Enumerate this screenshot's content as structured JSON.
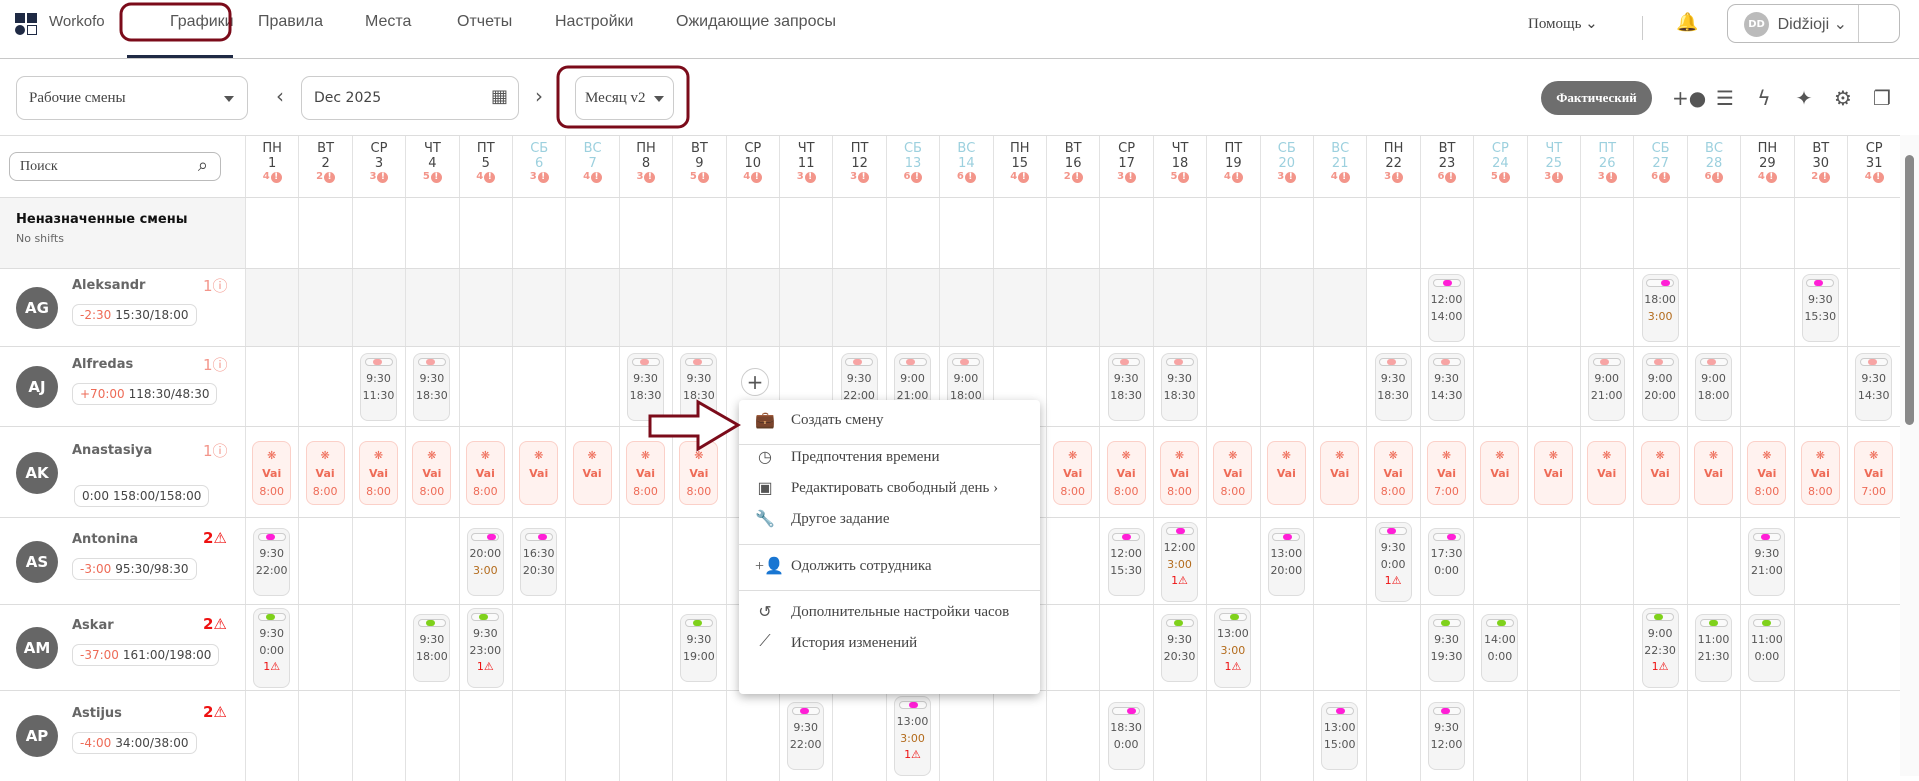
{
  "nav": {
    "brand": "Workofo",
    "tabs": [
      "Графики",
      "Правила",
      "Места",
      "Отчеты",
      "Настройки",
      "Ожидающие запросы"
    ],
    "active_tab": "Графики",
    "help": "Помощь ⌄",
    "user": "Didžioji ⌄",
    "user_initials": "DD"
  },
  "toolbar": {
    "view_select": "Рабочие смены",
    "date": "Dec 2025",
    "mode_select": "Месяц v2",
    "actual_button": "Фактический",
    "icons": [
      "person-add-icon",
      "tune-icon",
      "flash-icon",
      "sparkles-icon",
      "gear-icon",
      "copy-icon"
    ]
  },
  "search": {
    "placeholder": "Поиск"
  },
  "days": [
    {
      "w": "ПН",
      "n": "1",
      "c": "4",
      "we": false
    },
    {
      "w": "ВТ",
      "n": "2",
      "c": "2",
      "we": false
    },
    {
      "w": "СР",
      "n": "3",
      "c": "3",
      "we": false
    },
    {
      "w": "ЧТ",
      "n": "4",
      "c": "5",
      "we": false
    },
    {
      "w": "ПТ",
      "n": "5",
      "c": "4",
      "we": false
    },
    {
      "w": "СБ",
      "n": "6",
      "c": "3",
      "we": true
    },
    {
      "w": "ВС",
      "n": "7",
      "c": "4",
      "we": true
    },
    {
      "w": "ПН",
      "n": "8",
      "c": "3",
      "we": false
    },
    {
      "w": "ВТ",
      "n": "9",
      "c": "5",
      "we": false
    },
    {
      "w": "СР",
      "n": "10",
      "c": "4",
      "we": false
    },
    {
      "w": "ЧТ",
      "n": "11",
      "c": "3",
      "we": false
    },
    {
      "w": "ПТ",
      "n": "12",
      "c": "3",
      "we": false
    },
    {
      "w": "СБ",
      "n": "13",
      "c": "6",
      "we": true
    },
    {
      "w": "ВС",
      "n": "14",
      "c": "6",
      "we": true
    },
    {
      "w": "ПН",
      "n": "15",
      "c": "4",
      "we": false
    },
    {
      "w": "ВТ",
      "n": "16",
      "c": "2",
      "we": false
    },
    {
      "w": "СР",
      "n": "17",
      "c": "3",
      "we": false
    },
    {
      "w": "ЧТ",
      "n": "18",
      "c": "5",
      "we": false
    },
    {
      "w": "ПТ",
      "n": "19",
      "c": "4",
      "we": false
    },
    {
      "w": "СБ",
      "n": "20",
      "c": "3",
      "we": true
    },
    {
      "w": "ВС",
      "n": "21",
      "c": "4",
      "we": true
    },
    {
      "w": "ПН",
      "n": "22",
      "c": "3",
      "we": false
    },
    {
      "w": "ВТ",
      "n": "23",
      "c": "6",
      "we": false
    },
    {
      "w": "СР",
      "n": "24",
      "c": "5",
      "we": true
    },
    {
      "w": "ЧТ",
      "n": "25",
      "c": "3",
      "we": true
    },
    {
      "w": "ПТ",
      "n": "26",
      "c": "3",
      "we": true
    },
    {
      "w": "СБ",
      "n": "27",
      "c": "6",
      "we": true
    },
    {
      "w": "ВС",
      "n": "28",
      "c": "6",
      "we": true
    },
    {
      "w": "ПН",
      "n": "29",
      "c": "4",
      "we": false
    },
    {
      "w": "ВТ",
      "n": "30",
      "c": "2",
      "we": false
    },
    {
      "w": "СР",
      "n": "31",
      "c": "4",
      "we": false
    }
  ],
  "unassigned": {
    "title": "Неназначенные смены",
    "subtitle": "No shifts"
  },
  "employees": [
    {
      "initials": "AG",
      "name": "Aleksandr",
      "alert": "1ⓘ",
      "alert_type": "info",
      "diff": "-2:30",
      "hours": "15:30/18:00",
      "color": "#ff1fd6",
      "unavailable_through_day": 21,
      "shifts": [
        {
          "day": 23,
          "start": "12:00",
          "end": "14:00"
        },
        {
          "day": 27,
          "start": "18:00",
          "end": "3:00"
        },
        {
          "day": 30,
          "start": "9:30",
          "end": "15:30"
        }
      ]
    },
    {
      "initials": "AJ",
      "name": "Alfredas",
      "alert": "1ⓘ",
      "alert_type": "info",
      "diff": "+70:00",
      "hours": "118:30/48:30",
      "color": "#f7a4a4",
      "shifts": [
        {
          "day": 3,
          "start": "9:30",
          "end": "11:30"
        },
        {
          "day": 4,
          "start": "9:30",
          "end": "18:30"
        },
        {
          "day": 8,
          "start": "9:30",
          "end": "18:30"
        },
        {
          "day": 9,
          "start": "9:30",
          "end": "18:30"
        },
        {
          "day": 12,
          "start": "9:30",
          "end": "22:00"
        },
        {
          "day": 13,
          "start": "9:00",
          "end": "21:00"
        },
        {
          "day": 14,
          "start": "9:00",
          "end": "18:00"
        },
        {
          "day": 17,
          "start": "9:30",
          "end": "18:30"
        },
        {
          "day": 18,
          "start": "9:30",
          "end": "18:30"
        },
        {
          "day": 22,
          "start": "9:30",
          "end": "18:30"
        },
        {
          "day": 23,
          "start": "9:30",
          "end": "14:30"
        },
        {
          "day": 26,
          "start": "9:00",
          "end": "21:00"
        },
        {
          "day": 27,
          "start": "9:00",
          "end": "20:00"
        },
        {
          "day": 28,
          "start": "9:00",
          "end": "18:00"
        },
        {
          "day": 31,
          "start": "9:30",
          "end": "14:30"
        }
      ]
    },
    {
      "initials": "AK",
      "name": "Anastasiya",
      "alert": "1ⓘ",
      "alert_type": "info",
      "diff": "0:00",
      "hours": "158:00/158:00",
      "color": "#ee6b57",
      "vacation_label": "Vai",
      "vacation": [
        {
          "day": 1,
          "h": "8:00"
        },
        {
          "day": 2,
          "h": "8:00"
        },
        {
          "day": 3,
          "h": "8:00"
        },
        {
          "day": 4,
          "h": "8:00"
        },
        {
          "day": 5,
          "h": "8:00"
        },
        {
          "day": 6,
          "h": ""
        },
        {
          "day": 7,
          "h": ""
        },
        {
          "day": 8,
          "h": "8:00"
        },
        {
          "day": 9,
          "h": "8:00"
        },
        {
          "day": 16,
          "h": "8:00"
        },
        {
          "day": 17,
          "h": "8:00"
        },
        {
          "day": 18,
          "h": "8:00"
        },
        {
          "day": 19,
          "h": "8:00"
        },
        {
          "day": 20,
          "h": ""
        },
        {
          "day": 21,
          "h": ""
        },
        {
          "day": 22,
          "h": "8:00"
        },
        {
          "day": 23,
          "h": "7:00"
        },
        {
          "day": 24,
          "h": ""
        },
        {
          "day": 25,
          "h": ""
        },
        {
          "day": 26,
          "h": ""
        },
        {
          "day": 27,
          "h": ""
        },
        {
          "day": 28,
          "h": ""
        },
        {
          "day": 29,
          "h": "8:00"
        },
        {
          "day": 30,
          "h": "8:00"
        },
        {
          "day": 31,
          "h": "7:00"
        }
      ]
    },
    {
      "initials": "AS",
      "name": "Antonina",
      "alert": "2⚠",
      "alert_type": "warn",
      "diff": "-3:00",
      "hours": "95:30/98:30",
      "color": "#ff1fd6",
      "shifts": [
        {
          "day": 1,
          "start": "9:30",
          "end": "22:00"
        },
        {
          "day": 5,
          "start": "20:00",
          "end": "3:00"
        },
        {
          "day": 6,
          "start": "16:30",
          "end": "20:30"
        },
        {
          "day": 17,
          "start": "12:00",
          "end": "15:30"
        },
        {
          "day": 18,
          "start": "12:00",
          "end": "3:00",
          "warn": "1⚠"
        },
        {
          "day": 20,
          "start": "13:00",
          "end": "20:00"
        },
        {
          "day": 22,
          "start": "9:30",
          "end": "0:00",
          "warn": "1⚠"
        },
        {
          "day": 23,
          "start": "17:30",
          "end": "0:00"
        },
        {
          "day": 29,
          "start": "9:30",
          "end": "21:00"
        }
      ]
    },
    {
      "initials": "AM",
      "name": "Askar",
      "alert": "2⚠",
      "alert_type": "warn",
      "diff": "-37:00",
      "hours": "161:00/198:00",
      "color": "#7fd11b",
      "shifts": [
        {
          "day": 1,
          "start": "9:30",
          "end": "0:00",
          "warn": "1⚠"
        },
        {
          "day": 4,
          "start": "9:30",
          "end": "18:00"
        },
        {
          "day": 5,
          "start": "9:30",
          "end": "23:00",
          "warn": "1⚠"
        },
        {
          "day": 9,
          "start": "9:30",
          "end": "19:00"
        },
        {
          "day": 18,
          "start": "9:30",
          "end": "20:30"
        },
        {
          "day": 19,
          "start": "13:00",
          "end": "3:00",
          "warn": "1⚠"
        },
        {
          "day": 23,
          "start": "9:30",
          "end": "19:30"
        },
        {
          "day": 24,
          "start": "14:00",
          "end": "0:00"
        },
        {
          "day": 27,
          "start": "9:00",
          "end": "22:30",
          "warn": "1⚠"
        },
        {
          "day": 28,
          "start": "11:00",
          "end": "21:30"
        },
        {
          "day": 29,
          "start": "11:00",
          "end": "0:00"
        }
      ]
    },
    {
      "initials": "AP",
      "name": "Astijus",
      "alert": "2⚠",
      "alert_type": "warn",
      "diff": "-4:00",
      "hours": "34:00/38:00",
      "color": "#ff1fd6",
      "shifts": [
        {
          "day": 11,
          "start": "9:30",
          "end": "22:00"
        },
        {
          "day": 13,
          "start": "13:00",
          "end": "3:00",
          "warn": "1⚠"
        },
        {
          "day": 17,
          "start": "18:30",
          "end": "0:00"
        },
        {
          "day": 21,
          "start": "13:00",
          "end": "15:00"
        },
        {
          "day": 23,
          "start": "9:30",
          "end": "12:00"
        }
      ]
    }
  ],
  "context_menu": {
    "items": [
      {
        "icon": "briefcase-icon",
        "glyph": "💼",
        "label": "Создать смену"
      },
      {
        "icon": "clock-icon",
        "glyph": "◷",
        "label": "Предпочтения времени"
      },
      {
        "icon": "calendar-x-icon",
        "glyph": "▣",
        "label": "Редактировать свободный день ›"
      },
      {
        "icon": "wrench-icon",
        "glyph": "🔧",
        "label": "Другое задание"
      },
      {
        "icon": "person-add-icon",
        "glyph": "+👤",
        "label": "Одолжить сотрудника"
      },
      {
        "icon": "history-icon",
        "glyph": "↺",
        "label": "Дополнительные настройки часов"
      },
      {
        "icon": "trending-icon",
        "glyph": "⟋",
        "label": "История изменений"
      }
    ]
  },
  "colors": {
    "accent": "#1f2a44",
    "annotation": "#7b0b1a",
    "alert": "#f3958a",
    "warning": "#ee1111",
    "weekend": "#9cd0de"
  }
}
